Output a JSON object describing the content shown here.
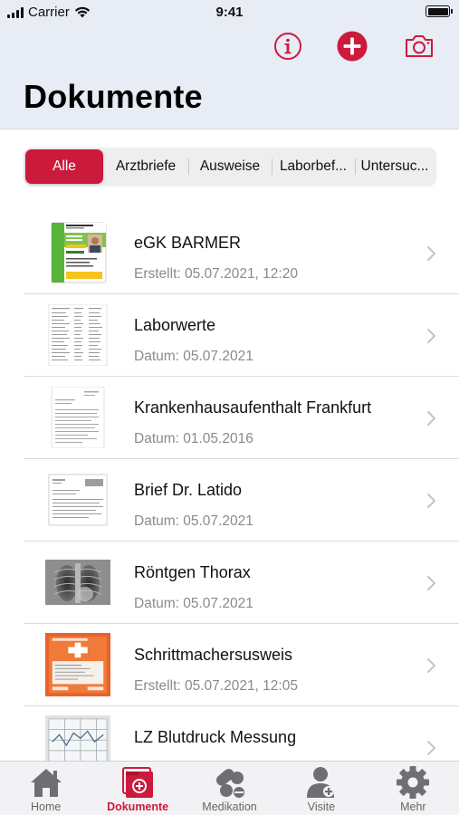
{
  "status_bar": {
    "carrier": "Carrier",
    "time": "9:41",
    "signal_icon": "signal-bars-icon",
    "wifi_icon": "wifi-icon",
    "battery_icon": "battery-icon"
  },
  "toolbar": {
    "info_icon": "info-icon",
    "add_icon": "add-circle-icon",
    "camera_icon": "camera-icon"
  },
  "page_title": "Dokumente",
  "accent_color": "#cc1a3c",
  "filters": [
    {
      "label": "Alle",
      "active": true
    },
    {
      "label": "Arztbriefe",
      "active": false
    },
    {
      "label": "Ausweise",
      "active": false
    },
    {
      "label": "Laborbef...",
      "active": false
    },
    {
      "label": "Untersuc...",
      "active": false
    }
  ],
  "documents": [
    {
      "title": "eGK BARMER",
      "subtitle": "Erstellt: 05.07.2021, 12:20",
      "thumbnail": "health-card-thumbnail"
    },
    {
      "title": "Laborwerte",
      "subtitle": "Datum: 05.07.2021",
      "thumbnail": "lab-report-thumbnail"
    },
    {
      "title": "Krankenhausaufenthalt Frankfurt",
      "subtitle": "Datum: 01.05.2016",
      "thumbnail": "document-thumbnail"
    },
    {
      "title": "Brief Dr. Latido",
      "subtitle": "Datum: 05.07.2021",
      "thumbnail": "letter-thumbnail"
    },
    {
      "title": "Röntgen Thorax",
      "subtitle": "Datum: 05.07.2021",
      "thumbnail": "xray-thumbnail"
    },
    {
      "title": "Schrittmachersusweis",
      "subtitle": "Erstellt: 05.07.2021, 12:05",
      "thumbnail": "pacemaker-card-thumbnail"
    },
    {
      "title": "LZ Blutdruck Messung",
      "subtitle": "",
      "thumbnail": "bloodpressure-chart-thumbnail"
    }
  ],
  "tabs": [
    {
      "label": "Home",
      "icon": "home-icon",
      "active": false
    },
    {
      "label": "Dokumente",
      "icon": "documents-icon",
      "active": true
    },
    {
      "label": "Medikation",
      "icon": "pills-icon",
      "active": false
    },
    {
      "label": "Visite",
      "icon": "doctor-icon",
      "active": false
    },
    {
      "label": "Mehr",
      "icon": "gear-icon",
      "active": false
    }
  ]
}
